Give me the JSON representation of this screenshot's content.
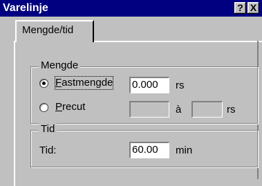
{
  "window": {
    "title": "Varelinje",
    "help_label": "?",
    "close_label": "X"
  },
  "tabs": [
    {
      "label": "Mengde/tid"
    }
  ],
  "mengde_group": {
    "legend": "Mengde",
    "fastmengde": {
      "accel": "F",
      "rest": "astmengde",
      "selected": true,
      "value": "0.000",
      "unit": "rs"
    },
    "precut": {
      "accel": "P",
      "rest": "recut",
      "selected": false,
      "value_from": "",
      "separator": "à",
      "value_to": "",
      "unit": "rs"
    }
  },
  "tid_group": {
    "legend": "Tid",
    "label": "Tid:",
    "value": "60.00",
    "unit": "min"
  }
}
